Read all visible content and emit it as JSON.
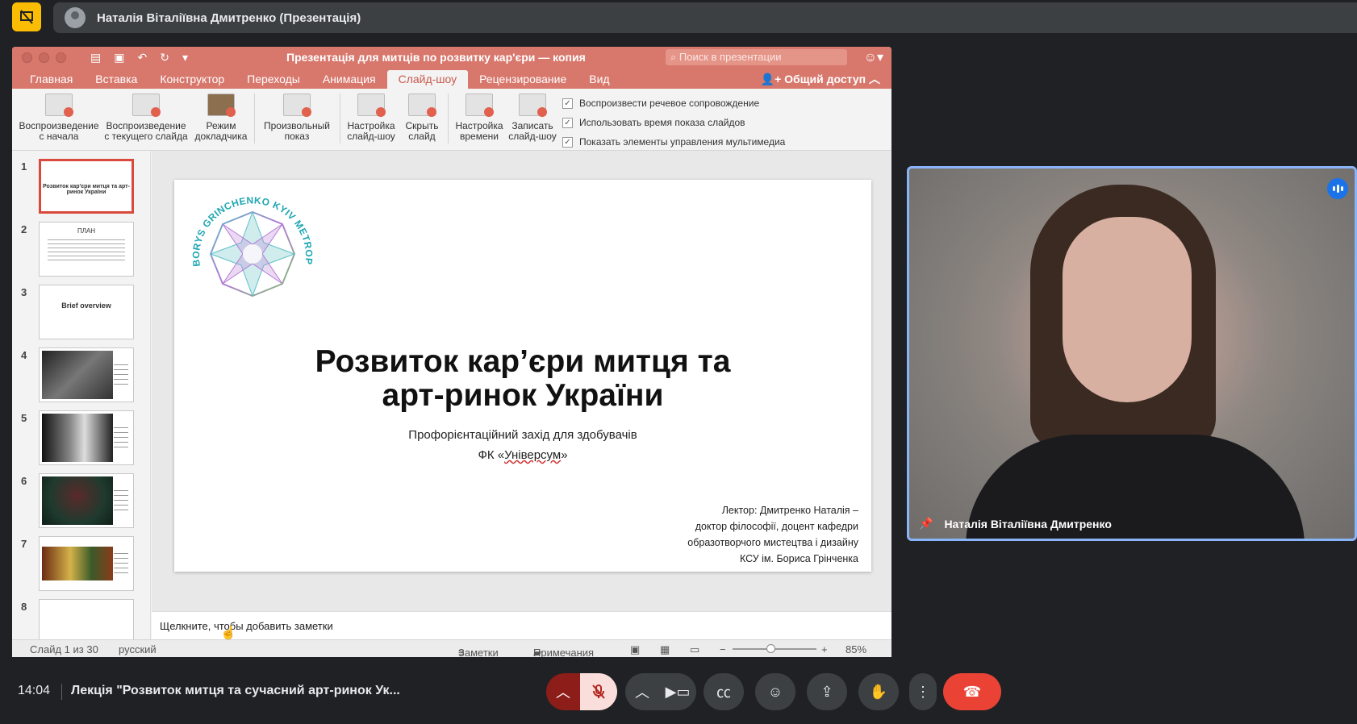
{
  "meet": {
    "presenter_chip": "Наталія Віталіївна Дмитренко (Презентація)",
    "time": "14:04",
    "meeting_title": "Лекція \"Розвиток митця та сучасний арт-ринок Ук...",
    "tile_name": "Наталія Віталіївна Дмитренко"
  },
  "ppt": {
    "doc_title": "Презентація для митців по розвитку кар'єри — копия",
    "search_placeholder": "Поиск в презентации",
    "share_label": "Общий доступ",
    "tabs": [
      "Главная",
      "Вставка",
      "Конструктор",
      "Переходы",
      "Анимация",
      "Слайд-шоу",
      "Рецензирование",
      "Вид"
    ],
    "ribbon": {
      "btn1": [
        "Воспроизведение",
        "с начала"
      ],
      "btn2": [
        "Воспроизведение",
        "с текущего слайда"
      ],
      "btn3": [
        "Режим",
        "докладчика"
      ],
      "btn4": [
        "Произвольный",
        "показ"
      ],
      "btn5": [
        "Настройка",
        "слайд-шоу"
      ],
      "btn6": [
        "Скрыть",
        "слайд"
      ],
      "btn7": [
        "Настройка",
        "времени"
      ],
      "btn8": [
        "Записать",
        "слайд-шоу"
      ],
      "check1": "Воспроизвести речевое сопровождение",
      "check2": "Использовать время показа слайдов",
      "check3": "Показать элементы управления мультимедиа"
    },
    "thumbs": [
      {
        "num": "1",
        "title": "Розвиток кар'єри митця та арт-ринок України"
      },
      {
        "num": "2",
        "title": "ПЛАН"
      },
      {
        "num": "3",
        "title": "Brief overview"
      },
      {
        "num": "4"
      },
      {
        "num": "5"
      },
      {
        "num": "6"
      },
      {
        "num": "7"
      },
      {
        "num": "8"
      }
    ],
    "slide": {
      "logo_text": "BORYS GRINCHENKO KYIV METROPOLITAN UNIVERSITY",
      "title_line1": "Розвиток кар’єри митця та",
      "title_line2": "арт-ринок України",
      "sub_line1": "Профорієнтаційний захід для здобувачів",
      "sub_line2_a": "ФК «",
      "sub_line2_b": "Універсум",
      "sub_line2_c": "»",
      "lect1": "Лектор: Дмитренко Наталія –",
      "lect2": "доктор філософії, доцент кафедри",
      "lect3": "образотворчого мистецтва і дизайну",
      "lect4": "КСУ ім. Бориса Грінченка"
    },
    "notes_placeholder": "Щелкните, чтобы добавить заметки",
    "status": {
      "slide_of": "Слайд 1 из 30",
      "lang": "русский",
      "notes": "Заметки",
      "comments": "Примечания",
      "zoom": "85%"
    }
  },
  "colors": {
    "ppt_accent": "#d8776c",
    "meet_bg": "#202124",
    "end_call": "#ea4335"
  }
}
